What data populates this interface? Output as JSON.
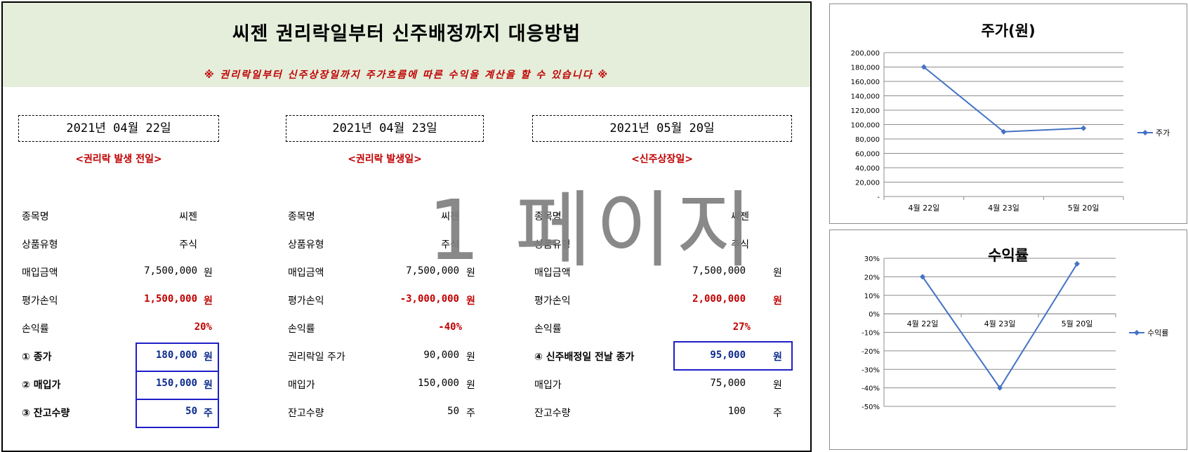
{
  "banner": {
    "title": "씨젠 권리락일부터 신주배정까지 대응방법",
    "subtitle": "※ 권리락일부터 신주상장일까지 주가흐름에 따른 수익을 계산을 할 수 있습니다 ※",
    "bg_color": "#e4eedb"
  },
  "watermark": "1 페이지",
  "columns": [
    {
      "date": "2021년 04월 22일",
      "sub": "<권리락 발생 전일>",
      "rows": [
        {
          "label": "종목명",
          "value": "씨젠",
          "unit": ""
        },
        {
          "label": "상품유형",
          "value": "주식",
          "unit": ""
        },
        {
          "label": "매입금액",
          "value": "7,500,000",
          "unit": "원"
        },
        {
          "label": "평가손익",
          "value": "1,500,000",
          "unit": "원"
        },
        {
          "label": "손익률",
          "value": "20%",
          "unit": ""
        },
        {
          "label": "① 종가",
          "value": "180,000",
          "unit": "원"
        },
        {
          "label": "② 매입가",
          "value": "150,000",
          "unit": "원"
        },
        {
          "label": "③ 잔고수량",
          "value": "50",
          "unit": "주"
        }
      ]
    },
    {
      "date": "2021년 04월 23일",
      "sub": "<권리락 발생일>",
      "rows": [
        {
          "label": "종목명",
          "value": "씨젠",
          "unit": ""
        },
        {
          "label": "상품유형",
          "value": "주식",
          "unit": ""
        },
        {
          "label": "매입금액",
          "value": "7,500,000",
          "unit": "원"
        },
        {
          "label": "평가손익",
          "value": "-3,000,000",
          "unit": "원"
        },
        {
          "label": "손익률",
          "value": "-40%",
          "unit": ""
        },
        {
          "label": "권리락일 주가",
          "value": "90,000",
          "unit": "원"
        },
        {
          "label": "매입가",
          "value": "150,000",
          "unit": "원"
        },
        {
          "label": "잔고수량",
          "value": "50",
          "unit": "주"
        }
      ]
    },
    {
      "date": "2021년 05월 20일",
      "sub": "<신주상장일>",
      "rows": [
        {
          "label": "종목명",
          "value": "씨젠",
          "unit": ""
        },
        {
          "label": "상품유형",
          "value": "주식",
          "unit": ""
        },
        {
          "label": "매입금액",
          "value": "7,500,000",
          "unit": "원"
        },
        {
          "label": "평가손익",
          "value": "2,000,000",
          "unit": "원"
        },
        {
          "label": "손익률",
          "value": "27%",
          "unit": ""
        },
        {
          "label": "④ 신주배정일 전날 종가",
          "value": "95,000",
          "unit": "원"
        },
        {
          "label": "매입가",
          "value": "75,000",
          "unit": "원"
        },
        {
          "label": "잔고수량",
          "value": "100",
          "unit": "주"
        }
      ]
    }
  ],
  "chart_data": [
    {
      "type": "line",
      "title": "주가(원)",
      "categories": [
        "4월 22일",
        "4월 23일",
        "5월 20일"
      ],
      "series": [
        {
          "name": "주가",
          "values": [
            180000,
            90000,
            95000
          ],
          "color": "#4472c4"
        }
      ],
      "ylim": [
        0,
        200000
      ],
      "yticks": [
        "200,000",
        "180,000",
        "160,000",
        "140,000",
        "120,000",
        "100,000",
        "80,000",
        "60,000",
        "40,000",
        "20,000",
        "-"
      ],
      "grid": true,
      "legend": "right"
    },
    {
      "type": "line",
      "title": "수익률",
      "categories": [
        "4월 22일",
        "4월 23일",
        "5월 20일"
      ],
      "series": [
        {
          "name": "수익률",
          "values": [
            20,
            -40,
            27
          ],
          "color": "#4472c4"
        }
      ],
      "ylim": [
        -50,
        30
      ],
      "yticks": [
        "30%",
        "20%",
        "10%",
        "0%",
        "-10%",
        "-20%",
        "-30%",
        "-40%",
        "-50%"
      ],
      "grid": true,
      "legend": "right"
    }
  ]
}
